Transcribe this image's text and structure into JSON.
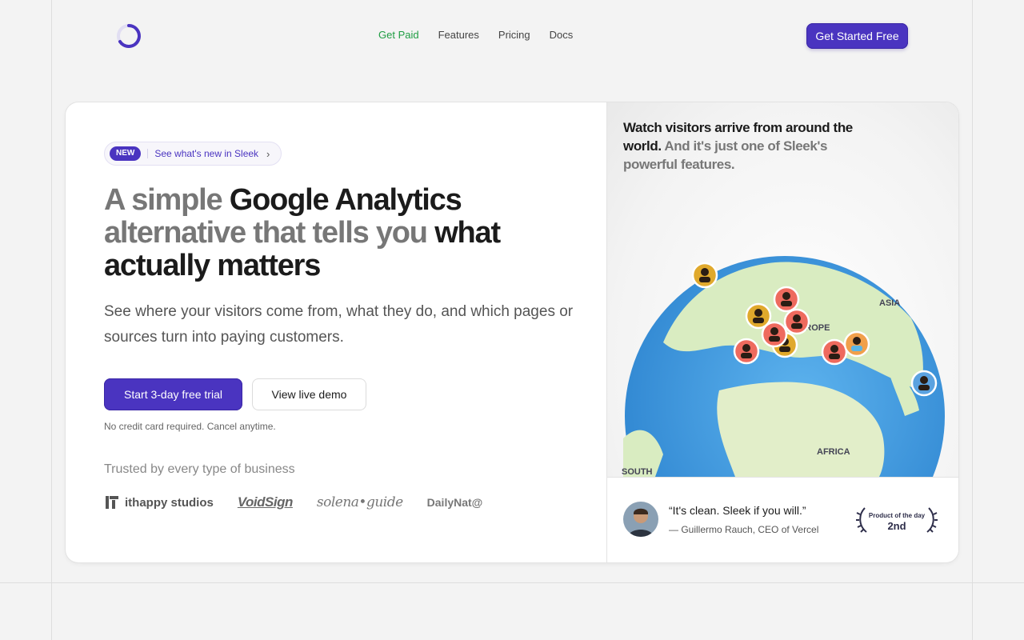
{
  "nav": {
    "links": [
      {
        "label": "Get Paid",
        "active": true
      },
      {
        "label": "Features"
      },
      {
        "label": "Pricing"
      },
      {
        "label": "Docs"
      }
    ],
    "cta": "Get Started Free"
  },
  "hero": {
    "pill": {
      "badge": "NEW",
      "text": "See what's new in Sleek"
    },
    "headline": {
      "muted_1": "A simple ",
      "strong_1": "Google Analytics",
      "muted_2": "alternative that tells you ",
      "strong_2": "what actually matters"
    },
    "subtitle": "See where your visitors come from, what they do, and which pages or sources turn into paying customers.",
    "primary_button": "Start 3-day free trial",
    "secondary_button": "View live demo",
    "note": "No credit card required. Cancel anytime.",
    "trusted_heading": "Trusted by every type of business",
    "logos": [
      "ithappy studios",
      "VoidSign",
      "solena•guide",
      "DailyNat@"
    ]
  },
  "globe": {
    "caption_strong": "Watch visitors arrive from around the world.",
    "caption_muted": " And it's just one of Sleek's powerful features.",
    "labels": [
      "ASIA",
      "EUROPE",
      "AFRICA",
      "SOUTH"
    ]
  },
  "testimonial": {
    "quote": "“It's clean. Sleek if you will.”",
    "author": "— Guillermo Rauch, CEO of Vercel",
    "award_title": "Product of the day",
    "award_rank": "2nd"
  },
  "colors": {
    "accent": "#4a34c0",
    "active_link": "#1f9d43",
    "ocean": "#3f9be0",
    "land": "#d9ecc1"
  }
}
